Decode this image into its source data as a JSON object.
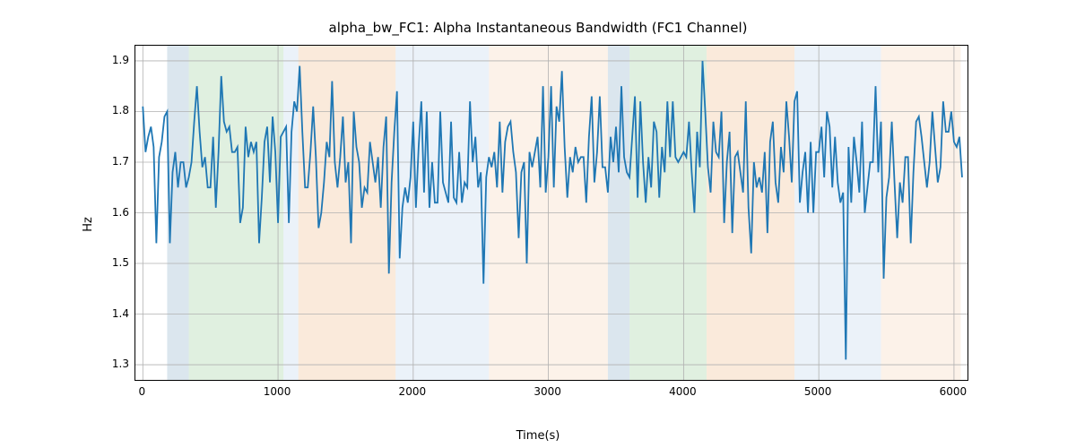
{
  "chart_data": {
    "type": "line",
    "title": "alpha_bw_FC1: Alpha Instantaneous Bandwidth (FC1 Channel)",
    "xlabel": "Time(s)",
    "ylabel": "Hz",
    "xlim": [
      -55,
      6100
    ],
    "ylim": [
      1.27,
      1.93
    ],
    "xticks": [
      0,
      1000,
      2000,
      3000,
      4000,
      5000,
      6000
    ],
    "yticks": [
      1.3,
      1.4,
      1.5,
      1.6,
      1.7,
      1.8,
      1.9
    ],
    "bands": [
      {
        "x0": 180,
        "x1": 340,
        "color": "#98b8cf"
      },
      {
        "x0": 340,
        "x1": 1040,
        "color": "#a7d3a7"
      },
      {
        "x0": 1040,
        "x1": 1150,
        "color": "#c6d9ed"
      },
      {
        "x0": 1150,
        "x1": 1870,
        "color": "#f1c297"
      },
      {
        "x0": 1870,
        "x1": 2560,
        "color": "#c6d9ed"
      },
      {
        "x0": 2560,
        "x1": 3440,
        "color": "#f6dbc0"
      },
      {
        "x0": 3440,
        "x1": 3600,
        "color": "#98b8cf"
      },
      {
        "x0": 3600,
        "x1": 4170,
        "color": "#a7d3a7"
      },
      {
        "x0": 4170,
        "x1": 4820,
        "color": "#f1c297"
      },
      {
        "x0": 4820,
        "x1": 4950,
        "color": "#c6d9ed"
      },
      {
        "x0": 4950,
        "x1": 5460,
        "color": "#c6d9ed"
      },
      {
        "x0": 5460,
        "x1": 6050,
        "color": "#f6dbc0"
      }
    ],
    "x": [
      0,
      20,
      40,
      60,
      80,
      100,
      120,
      140,
      160,
      180,
      200,
      220,
      240,
      260,
      280,
      300,
      320,
      340,
      360,
      380,
      400,
      420,
      440,
      460,
      480,
      500,
      520,
      540,
      560,
      580,
      600,
      620,
      640,
      660,
      680,
      700,
      720,
      740,
      760,
      780,
      800,
      820,
      840,
      860,
      880,
      900,
      920,
      940,
      960,
      980,
      1000,
      1020,
      1040,
      1060,
      1080,
      1100,
      1120,
      1140,
      1160,
      1180,
      1200,
      1220,
      1240,
      1260,
      1280,
      1300,
      1320,
      1340,
      1360,
      1380,
      1400,
      1420,
      1440,
      1460,
      1480,
      1500,
      1520,
      1540,
      1560,
      1580,
      1600,
      1620,
      1640,
      1660,
      1680,
      1700,
      1720,
      1740,
      1760,
      1780,
      1800,
      1820,
      1840,
      1860,
      1880,
      1900,
      1920,
      1940,
      1960,
      1980,
      2000,
      2020,
      2040,
      2060,
      2080,
      2100,
      2120,
      2140,
      2160,
      2180,
      2200,
      2220,
      2240,
      2260,
      2280,
      2300,
      2320,
      2340,
      2360,
      2380,
      2400,
      2420,
      2440,
      2460,
      2480,
      2500,
      2520,
      2540,
      2560,
      2580,
      2600,
      2620,
      2640,
      2660,
      2680,
      2700,
      2720,
      2740,
      2760,
      2780,
      2800,
      2820,
      2840,
      2860,
      2880,
      2900,
      2920,
      2940,
      2960,
      2980,
      3000,
      3020,
      3040,
      3060,
      3080,
      3100,
      3120,
      3140,
      3160,
      3180,
      3200,
      3220,
      3240,
      3260,
      3280,
      3300,
      3320,
      3340,
      3360,
      3380,
      3400,
      3420,
      3440,
      3460,
      3480,
      3500,
      3520,
      3540,
      3560,
      3580,
      3600,
      3620,
      3640,
      3660,
      3680,
      3700,
      3720,
      3740,
      3760,
      3780,
      3800,
      3820,
      3840,
      3860,
      3880,
      3900,
      3920,
      3940,
      3960,
      3980,
      4000,
      4020,
      4040,
      4060,
      4080,
      4100,
      4120,
      4140,
      4160,
      4180,
      4200,
      4220,
      4240,
      4260,
      4280,
      4300,
      4320,
      4340,
      4360,
      4380,
      4400,
      4420,
      4440,
      4460,
      4480,
      4500,
      4520,
      4540,
      4560,
      4580,
      4600,
      4620,
      4640,
      4660,
      4680,
      4700,
      4720,
      4740,
      4760,
      4780,
      4800,
      4820,
      4840,
      4860,
      4880,
      4900,
      4920,
      4940,
      4960,
      4980,
      5000,
      5020,
      5040,
      5060,
      5080,
      5100,
      5120,
      5140,
      5160,
      5180,
      5200,
      5220,
      5240,
      5260,
      5280,
      5300,
      5320,
      5340,
      5360,
      5380,
      5400,
      5420,
      5440,
      5460,
      5480,
      5500,
      5520,
      5540,
      5560,
      5580,
      5600,
      5620,
      5640,
      5660,
      5680,
      5700,
      5720,
      5740,
      5760,
      5780,
      5800,
      5820,
      5840,
      5860,
      5880,
      5900,
      5920,
      5940,
      5960,
      5980,
      6000,
      6020,
      6040,
      6060
    ],
    "values": [
      1.81,
      1.72,
      1.75,
      1.77,
      1.73,
      1.54,
      1.71,
      1.74,
      1.79,
      1.8,
      1.54,
      1.68,
      1.72,
      1.65,
      1.7,
      1.7,
      1.65,
      1.67,
      1.7,
      1.78,
      1.85,
      1.76,
      1.69,
      1.71,
      1.65,
      1.65,
      1.75,
      1.61,
      1.72,
      1.87,
      1.78,
      1.76,
      1.77,
      1.72,
      1.72,
      1.73,
      1.58,
      1.61,
      1.77,
      1.71,
      1.74,
      1.72,
      1.74,
      1.54,
      1.63,
      1.74,
      1.77,
      1.66,
      1.79,
      1.72,
      1.58,
      1.75,
      1.76,
      1.77,
      1.58,
      1.76,
      1.82,
      1.8,
      1.89,
      1.76,
      1.65,
      1.65,
      1.72,
      1.81,
      1.71,
      1.57,
      1.6,
      1.66,
      1.74,
      1.71,
      1.86,
      1.7,
      1.65,
      1.71,
      1.79,
      1.66,
      1.7,
      1.54,
      1.8,
      1.73,
      1.7,
      1.61,
      1.65,
      1.64,
      1.74,
      1.7,
      1.66,
      1.71,
      1.61,
      1.73,
      1.79,
      1.48,
      1.66,
      1.76,
      1.84,
      1.51,
      1.61,
      1.65,
      1.62,
      1.67,
      1.78,
      1.61,
      1.73,
      1.82,
      1.64,
      1.8,
      1.61,
      1.7,
      1.62,
      1.62,
      1.8,
      1.66,
      1.64,
      1.62,
      1.78,
      1.63,
      1.62,
      1.72,
      1.62,
      1.66,
      1.65,
      1.82,
      1.7,
      1.75,
      1.65,
      1.68,
      1.46,
      1.67,
      1.71,
      1.69,
      1.72,
      1.65,
      1.78,
      1.64,
      1.74,
      1.77,
      1.78,
      1.72,
      1.68,
      1.55,
      1.68,
      1.7,
      1.5,
      1.72,
      1.69,
      1.72,
      1.75,
      1.65,
      1.85,
      1.64,
      1.71,
      1.85,
      1.65,
      1.81,
      1.78,
      1.88,
      1.73,
      1.63,
      1.71,
      1.68,
      1.73,
      1.7,
      1.71,
      1.71,
      1.62,
      1.75,
      1.83,
      1.66,
      1.72,
      1.83,
      1.69,
      1.69,
      1.64,
      1.75,
      1.7,
      1.77,
      1.68,
      1.85,
      1.71,
      1.68,
      1.67,
      1.75,
      1.83,
      1.63,
      1.82,
      1.7,
      1.62,
      1.71,
      1.65,
      1.78,
      1.76,
      1.63,
      1.73,
      1.68,
      1.82,
      1.71,
      1.82,
      1.71,
      1.7,
      1.71,
      1.72,
      1.71,
      1.78,
      1.68,
      1.6,
      1.76,
      1.69,
      1.9,
      1.8,
      1.69,
      1.64,
      1.78,
      1.72,
      1.71,
      1.8,
      1.58,
      1.7,
      1.76,
      1.56,
      1.71,
      1.72,
      1.68,
      1.64,
      1.82,
      1.61,
      1.52,
      1.7,
      1.65,
      1.67,
      1.64,
      1.72,
      1.56,
      1.74,
      1.78,
      1.66,
      1.62,
      1.73,
      1.68,
      1.82,
      1.75,
      1.66,
      1.82,
      1.84,
      1.62,
      1.68,
      1.72,
      1.6,
      1.74,
      1.6,
      1.72,
      1.72,
      1.77,
      1.67,
      1.8,
      1.77,
      1.65,
      1.75,
      1.66,
      1.62,
      1.64,
      1.31,
      1.73,
      1.62,
      1.75,
      1.7,
      1.64,
      1.78,
      1.6,
      1.65,
      1.7,
      1.7,
      1.85,
      1.68,
      1.78,
      1.47,
      1.63,
      1.67,
      1.78,
      1.66,
      1.55,
      1.66,
      1.62,
      1.71,
      1.71,
      1.54,
      1.68,
      1.78,
      1.79,
      1.75,
      1.7,
      1.65,
      1.7,
      1.8,
      1.73,
      1.66,
      1.69,
      1.82,
      1.76,
      1.76,
      1.8,
      1.74,
      1.73,
      1.75,
      1.67
    ]
  }
}
